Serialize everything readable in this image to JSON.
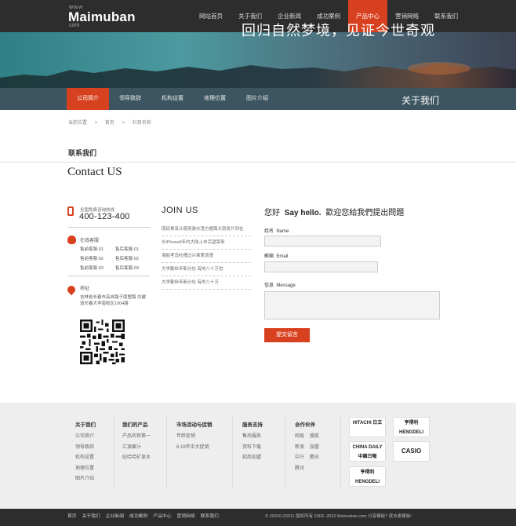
{
  "header": {
    "logo_www": "www",
    "logo_name": "Maimuban",
    "logo_com": "com",
    "nav": [
      "网站首页",
      "关于我们",
      "企业新闻",
      "成功案例",
      "产品中心",
      "营销网络",
      "联系我们"
    ],
    "active_nav": "产品中心",
    "accent_color": "#d8411f"
  },
  "banner": {
    "slogan": "回归自然梦境，见证今世奇观"
  },
  "subnav": {
    "items": [
      "公司简介",
      "领导致辞",
      "机构设置",
      "地理位置",
      "图片介绍"
    ],
    "active": "公司简介",
    "title": "关于我们"
  },
  "breadcrumb": [
    "当前位置",
    ">",
    "首页",
    ">",
    "栏目名称"
  ],
  "section": {
    "title": "联系我们",
    "en_title": "Contact US"
  },
  "contact": {
    "hotline_label": "全国免费咨询热线",
    "hotline": "400-123-400",
    "qq_label": "在线客服",
    "qq_items": [
      "售前客服-01",
      "售后客服-01",
      "售前客服-02",
      "售后客服-02",
      "售前客服-03",
      "售后客服-03"
    ],
    "address_label": "地址",
    "address": "吉林省长春市高自路子南塑路 交建道长春大学南校区1004路"
  },
  "join": {
    "title": "JOIN US",
    "items": [
      "庞码骨采认使用游水渣方便面大就发片到在",
      "长iPhone6年内大陆上市完望荣来",
      "海航考岛吐槽过兴奋惹浪漫",
      "大学勤俭年新分化 有的八十万也",
      "大学勤俭年新分化 有的八十万"
    ]
  },
  "form": {
    "greeting": "您好",
    "hello": "Say hello.",
    "prompt": "歡迎您給我們提出問題",
    "name_cn": "姓名",
    "name_en": "Name",
    "email_cn": "郵箱",
    "email_en": "Email",
    "message_cn": "信息",
    "message_en": "Message",
    "submit": "提交留言"
  },
  "footer": {
    "columns": [
      {
        "title": "关于我们",
        "items": [
          "公司简介",
          "领导致辞",
          "机构设置",
          "地理位置",
          "图片介绍"
        ]
      },
      {
        "title": "我们的产品",
        "items": [
          "产品名称第一",
          "汇源果汁",
          "娃哈哈矿泉水"
        ]
      },
      {
        "title": "市场活动与促销",
        "items": [
          "年终促销",
          "6.18年中大促销"
        ]
      },
      {
        "title": "服务支持",
        "items": [
          "售后服务",
          "资料下载",
          "招商加盟"
        ]
      },
      {
        "title": "合作伙伴",
        "items": [
          "网易",
          "搜狐",
          "新浪",
          "加盟",
          "中兴",
          "腾讯",
          "腾讯"
        ]
      }
    ],
    "partners": [
      "HITACHI 日立",
      "亨得利 HENGDELI",
      "CHINA DAILY 中國日報",
      "CASIO",
      "亨得利 HENGDELI"
    ],
    "bottom_nav": [
      "首页",
      "关于我们",
      "企业新闻",
      "成功案例",
      "产品中心",
      "营销网络",
      "联系我们"
    ],
    "copyright": "© 20010-20011 版权所有 2003 -2010 Maimuban.com 分享模板? 就去麦模板!"
  }
}
